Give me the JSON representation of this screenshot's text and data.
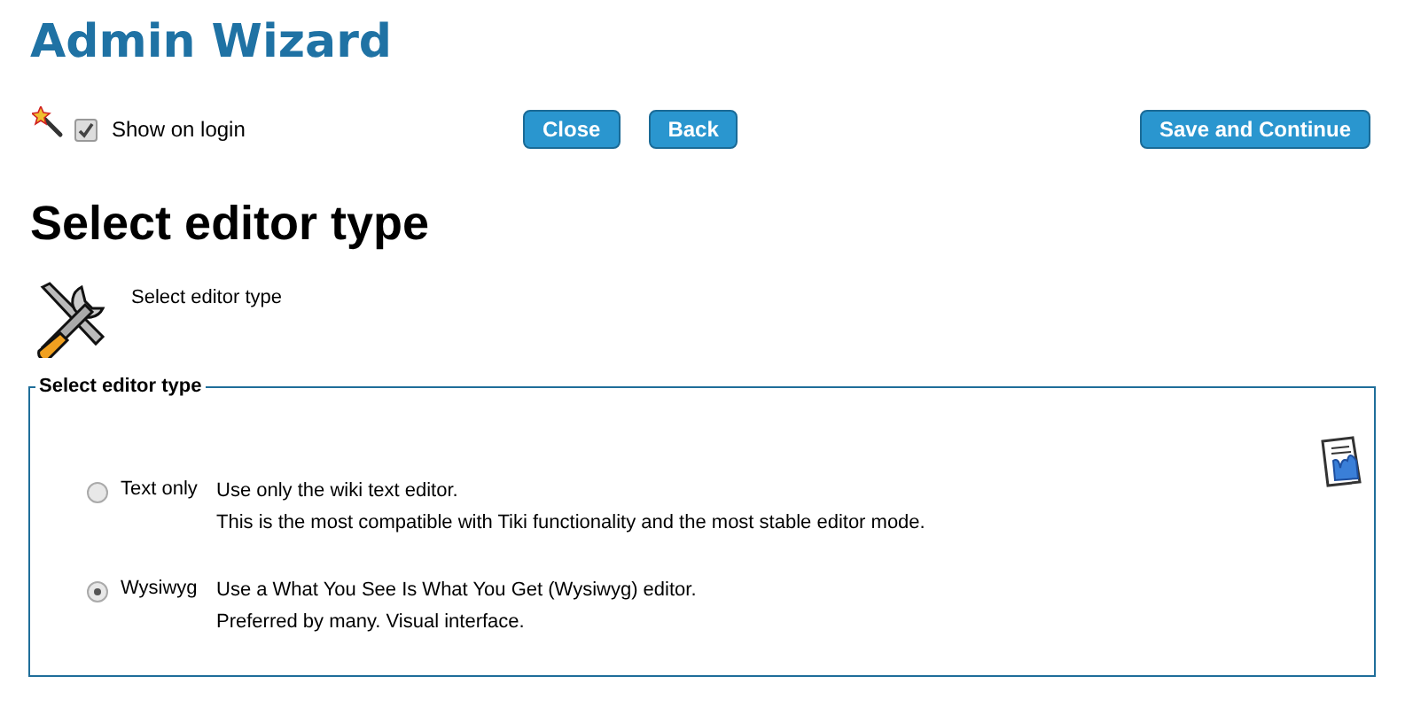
{
  "page_title": "Admin Wizard",
  "toolbar": {
    "show_on_login": {
      "label": "Show on login",
      "checked": true
    },
    "buttons": [
      "Close",
      "Back"
    ],
    "primary_button": "Save and Continue"
  },
  "heading": "Select editor type",
  "intro": "Select editor type",
  "fieldset": {
    "legend": "Select editor type",
    "options": [
      {
        "label": "Text only",
        "selected": false,
        "description": "Use only the wiki text editor.",
        "detail": "This is the most compatible with Tiki functionality and the most stable editor mode."
      },
      {
        "label": "Wysiwyg",
        "selected": true,
        "description": "Use a What You See Is What You Get (Wysiwyg) editor.",
        "detail": "Preferred by many. Visual interface."
      }
    ]
  }
}
